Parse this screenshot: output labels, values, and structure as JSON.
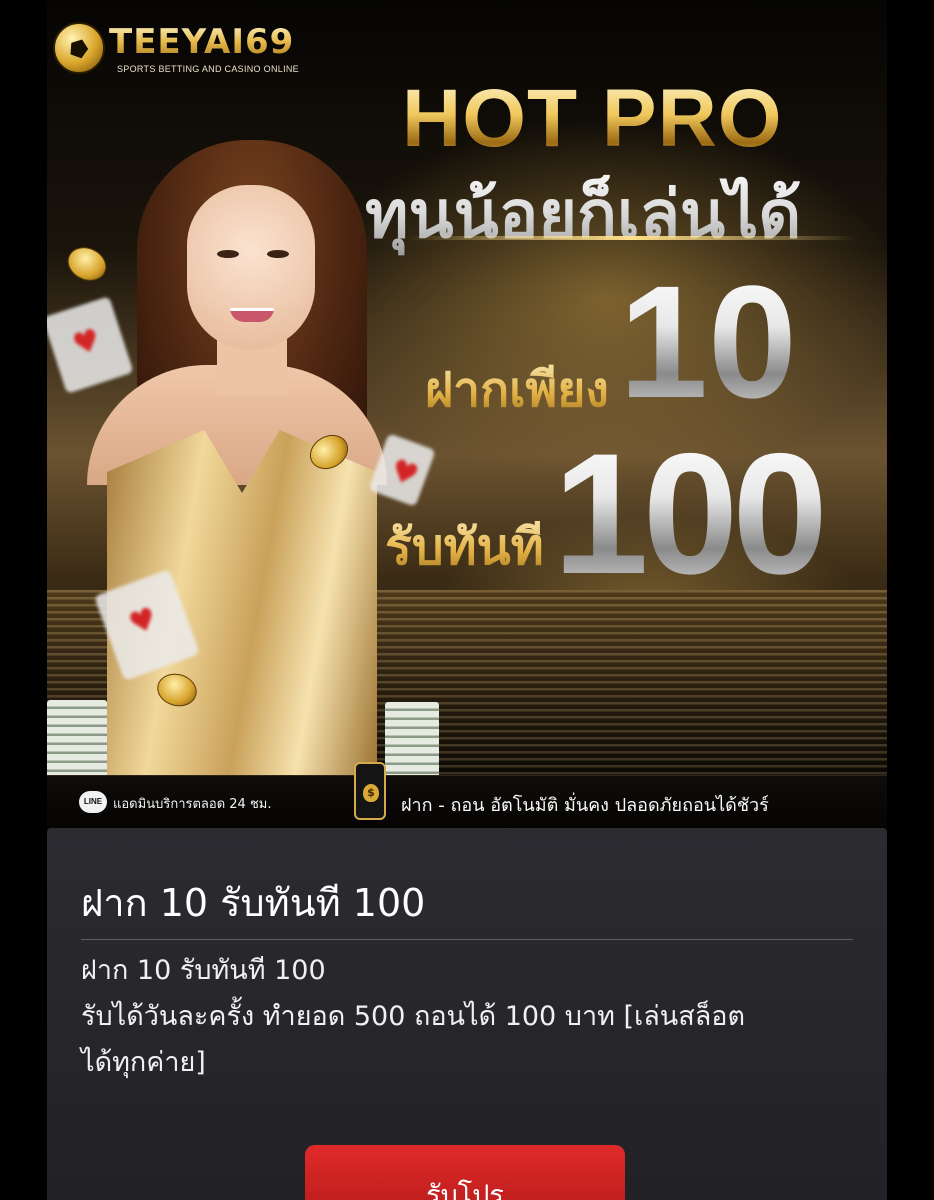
{
  "banner": {
    "logo": {
      "name": "TEEYAI69",
      "tagline": "SPORTS BETTING AND CASINO ONLINE"
    },
    "headline": "HOT PRO",
    "subheadline": "ทุนน้อยก็เล่นได้",
    "deposit_label": "ฝากเพียง",
    "deposit_amount": "10",
    "receive_label": "รับทันที",
    "receive_amount": "100",
    "line_icon_label": "LINE",
    "admin_text": "แอดมินบริการตลอด 24 ชม.",
    "wallet_icon_symbol": "$",
    "cashout_text": "ฝาก - ถอน อัตโนมัติ มั่นคง ปลอดภัยถอนได้ชัวร์",
    "accent_color": "#e2b043"
  },
  "promo": {
    "title": "ฝาก 10 รับทันที 100",
    "description_lines": [
      "ฝาก 10 รับทันที 100",
      "รับได้วันละครั้ง ทำยอด 500 ถอนได้ 100 บาท [เล่นสล็อต",
      "ได้ทุกค่าย]"
    ],
    "button_label": "รับโปร",
    "button_color": "#e12a2a"
  }
}
